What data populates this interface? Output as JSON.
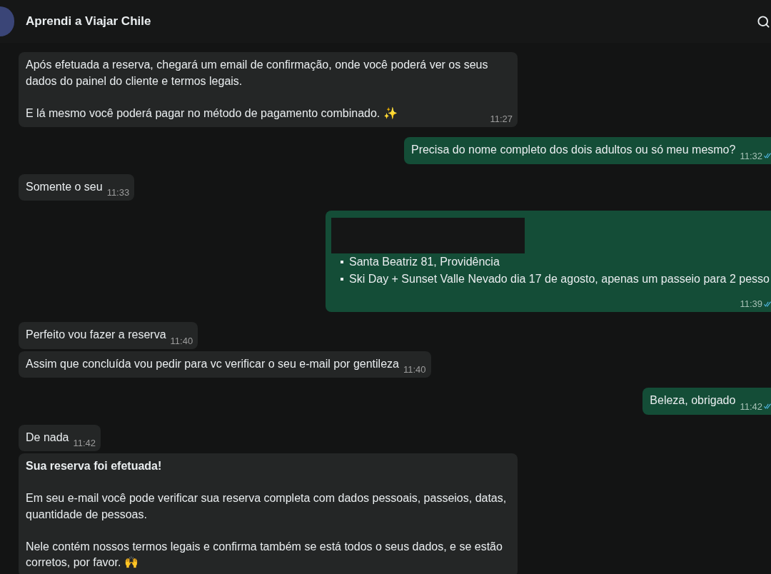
{
  "header": {
    "title": "Aprendi a Viajar Chile"
  },
  "messages": [
    {
      "outgoing": false,
      "blocks": [
        {
          "kind": "paragraph",
          "text": "Após efetuada a reserva, chegará um email de confirmação, onde você poderá ver os seus dados do painel do cliente e termos legais."
        },
        {
          "kind": "paragraph",
          "text": "E lá mesmo você poderá pagar no método de pagamento combinado. ✨"
        }
      ],
      "time": "11:27"
    },
    {
      "outgoing": true,
      "blocks": [
        {
          "kind": "paragraph",
          "text": "Precisa do nome completo dos dois adultos ou só meu mesmo?"
        }
      ],
      "time": "11:32",
      "read": true
    },
    {
      "outgoing": false,
      "blocks": [
        {
          "kind": "paragraph",
          "text": "Somente o seu"
        }
      ],
      "time": "11:33"
    },
    {
      "outgoing": true,
      "blocks": [
        {
          "kind": "redacted"
        },
        {
          "kind": "list_item",
          "text": "Santa Beatriz 81, Providência"
        },
        {
          "kind": "list_item",
          "text": "Ski Day + Sunset Valle Nevado dia 17 de agosto, apenas um passeio para 2 pesso"
        }
      ],
      "time": "11:39",
      "read": true
    },
    {
      "outgoing": false,
      "blocks": [
        {
          "kind": "paragraph",
          "text": "Perfeito vou fazer a reserva"
        }
      ],
      "time": "11:40"
    },
    {
      "outgoing": false,
      "blocks": [
        {
          "kind": "paragraph",
          "text": "Assim que concluída vou pedir para vc verificar o seu e-mail por gentileza"
        }
      ],
      "time": "11:40"
    },
    {
      "outgoing": true,
      "blocks": [
        {
          "kind": "paragraph",
          "text": "Beleza, obrigado"
        }
      ],
      "time": "11:42",
      "read": true
    },
    {
      "outgoing": false,
      "blocks": [
        {
          "kind": "paragraph",
          "text": "De nada"
        }
      ],
      "time": "11:42"
    },
    {
      "outgoing": false,
      "blocks": [
        {
          "kind": "heading",
          "text": "Sua reserva foi efetuada!"
        },
        {
          "kind": "paragraph",
          "text": "Em seu e-mail você pode verificar sua reserva completa com dados pessoais, passeios, datas, quantidade de pessoas."
        },
        {
          "kind": "paragraph",
          "text": "Nele contém nossos termos legais e confirma também se está todos o seus dados, e se estão corretos, por favor. 🙌"
        }
      ]
    }
  ]
}
